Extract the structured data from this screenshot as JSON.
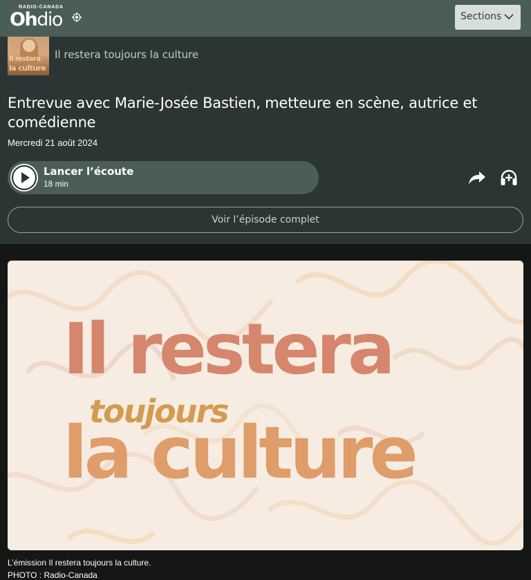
{
  "header": {
    "brand_top": "RADIO-CANADA",
    "brand_wordmark_bold": "Oh",
    "brand_wordmark": "dio",
    "sections_label": "Sections"
  },
  "show": {
    "name": "Il restera toujours la culture",
    "thumb_line1": "Il restera",
    "thumb_line2": "la culture"
  },
  "episode": {
    "title": "Entrevue avec Marie-Josée Bastien, metteure en scène, autrice et comédienne",
    "date": "Mercredi 21 août 2024",
    "play_label": "Lancer l’écoute",
    "duration": "18 min",
    "full_episode_label": "Voir l’épisode complet"
  },
  "hero": {
    "line1": "Il restera",
    "line2": "toujours",
    "line3": "la culture"
  },
  "caption": {
    "text": "L’émission Il restera toujours la culture.",
    "credit": "PHOTO : Radio-Canada"
  },
  "icons": {
    "share": "share-icon",
    "listen": "headphones-add-icon",
    "play": "play-icon",
    "chevron": "chevron-down-icon"
  },
  "colors": {
    "header_bg": "#4a5e57",
    "panel_bg": "#2b3533",
    "page_bg": "#141716",
    "accent_text": "#b9d3c8"
  }
}
